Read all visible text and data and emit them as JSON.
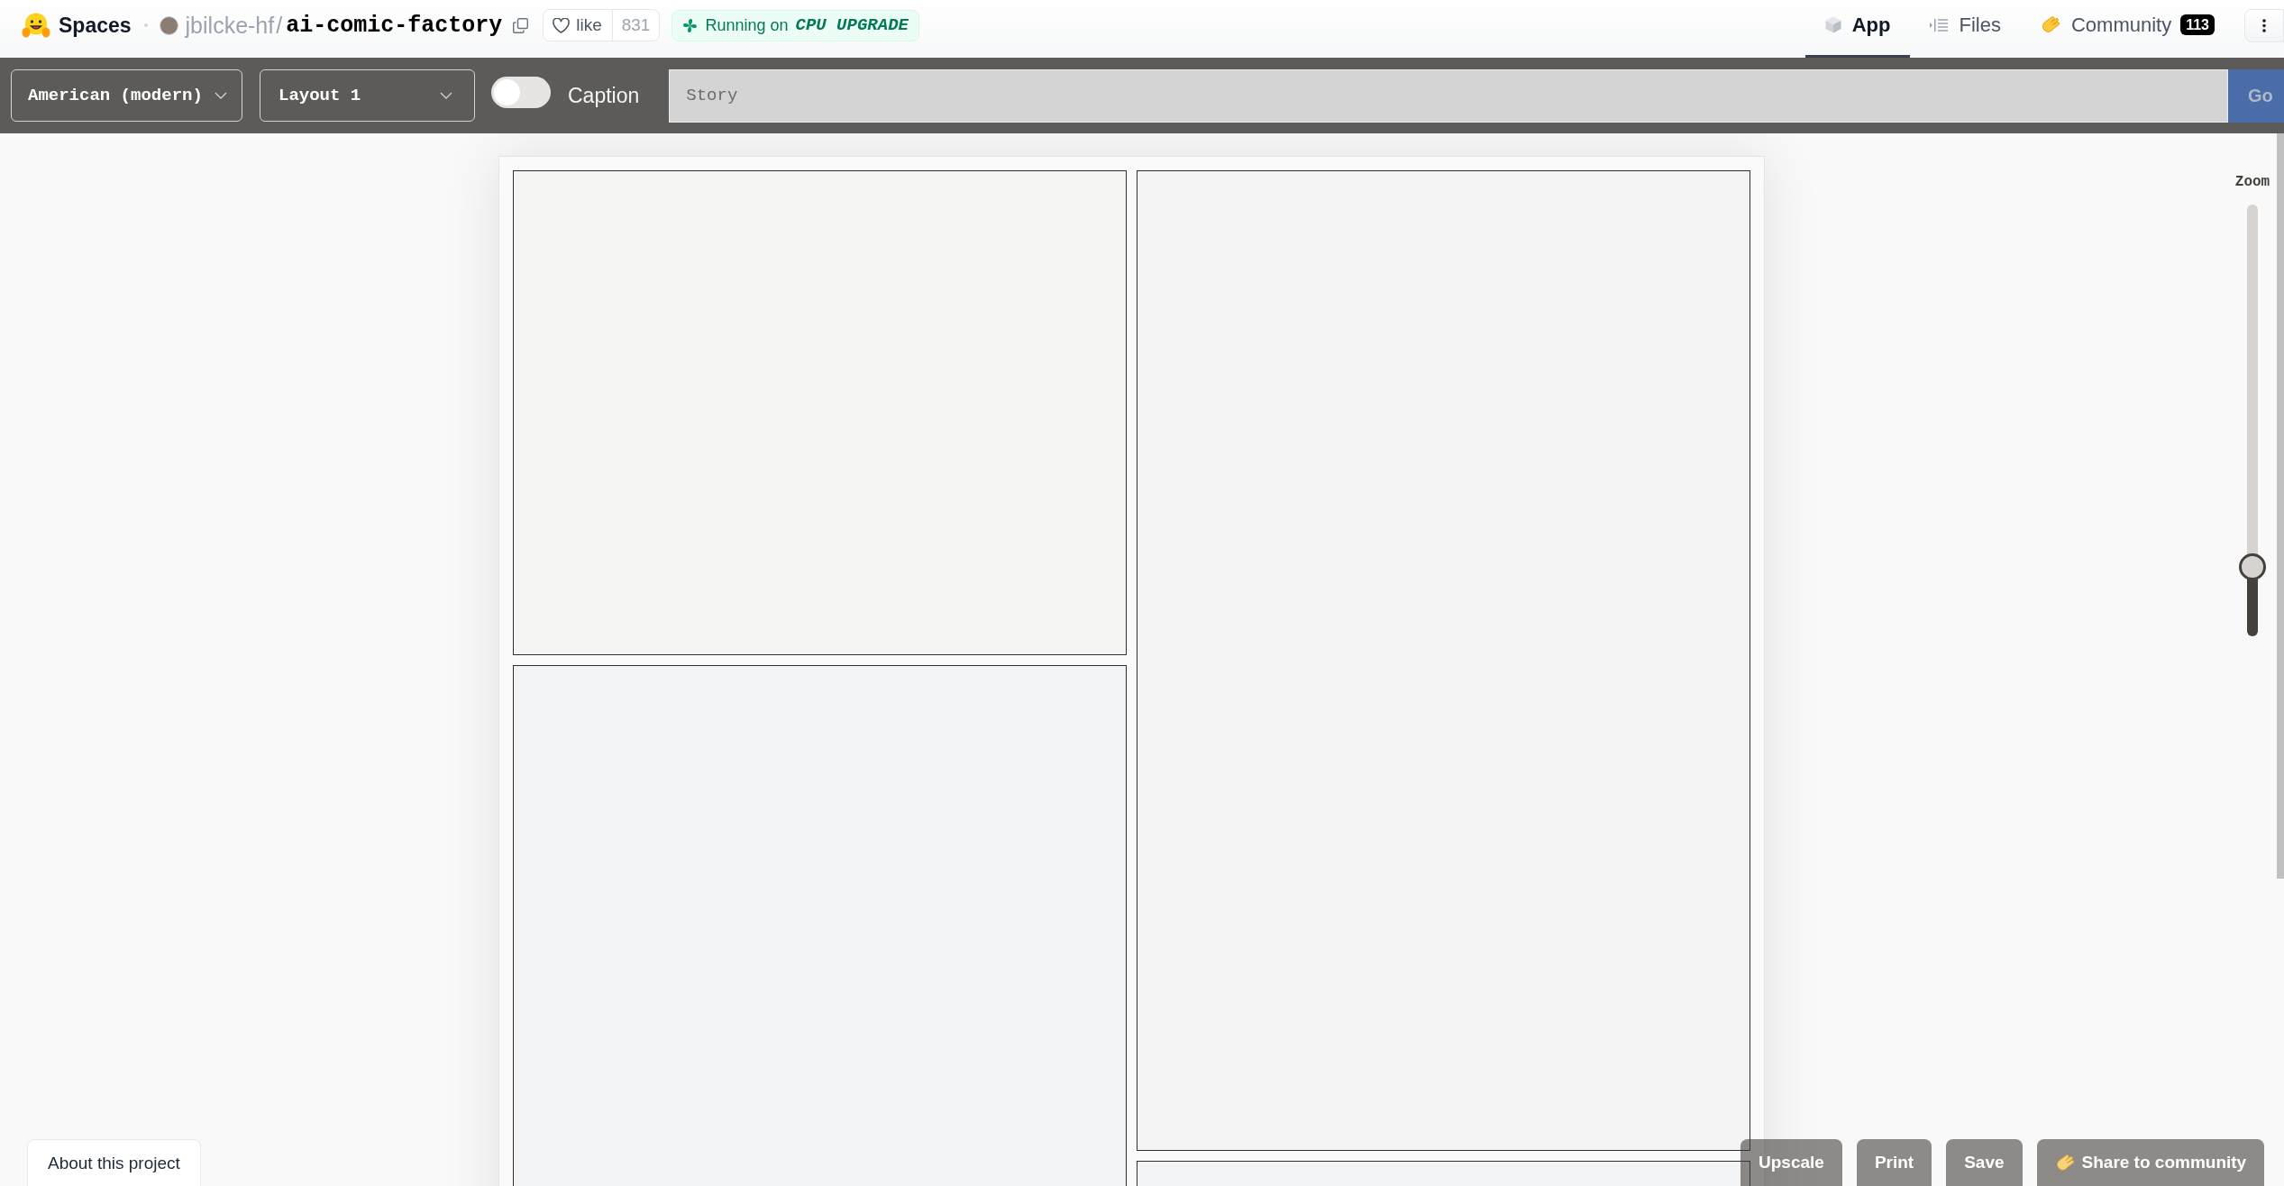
{
  "header": {
    "logo": "Spaces",
    "owner": "jbilcke-hf",
    "path_separator": "/",
    "repo": "ai-comic-factory",
    "like": {
      "label": "like",
      "count": "831"
    },
    "status": {
      "text": "Running on",
      "hardware": "CPU UPGRADE"
    },
    "tabs": [
      {
        "label": "App",
        "selected": true
      },
      {
        "label": "Files",
        "selected": false
      },
      {
        "label": "Community",
        "badge": "113",
        "selected": false
      }
    ]
  },
  "toolbar": {
    "style_dropdown": "American (modern)",
    "layout_dropdown": "Layout 1",
    "caption_toggle": {
      "label": "Caption",
      "on": false
    },
    "story": {
      "placeholder": "Story"
    },
    "go_button": "Go"
  },
  "zoom": {
    "label": "Zoom",
    "level": 0.16
  },
  "footer": {
    "about_button": "About this project",
    "actions": [
      {
        "label": "Upscale",
        "kind": "plain"
      },
      {
        "label": "Print",
        "kind": "plain"
      },
      {
        "label": "Save",
        "kind": "plain"
      },
      {
        "label": "Share to community",
        "kind": "share"
      }
    ]
  }
}
